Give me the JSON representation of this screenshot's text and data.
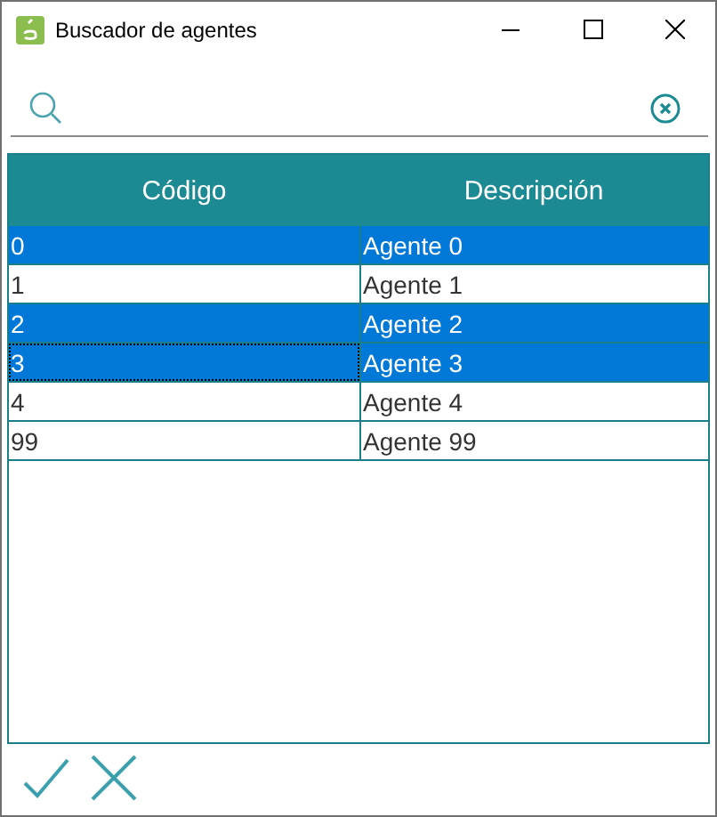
{
  "window": {
    "title": "Buscador de agentes"
  },
  "table": {
    "columns": [
      "Código",
      "Descripción"
    ],
    "rows": [
      {
        "cells": [
          "0",
          "Agente 0"
        ],
        "selected": true,
        "focused": false
      },
      {
        "cells": [
          "1",
          "Agente 1"
        ],
        "selected": false,
        "focused": false
      },
      {
        "cells": [
          "2",
          "Agente 2"
        ],
        "selected": true,
        "focused": false
      },
      {
        "cells": [
          "3",
          "Agente 3"
        ],
        "selected": true,
        "focused": true
      },
      {
        "cells": [
          "4",
          "Agente 4"
        ],
        "selected": false,
        "focused": false
      },
      {
        "cells": [
          "99",
          "Agente 99"
        ],
        "selected": false,
        "focused": false
      }
    ]
  }
}
